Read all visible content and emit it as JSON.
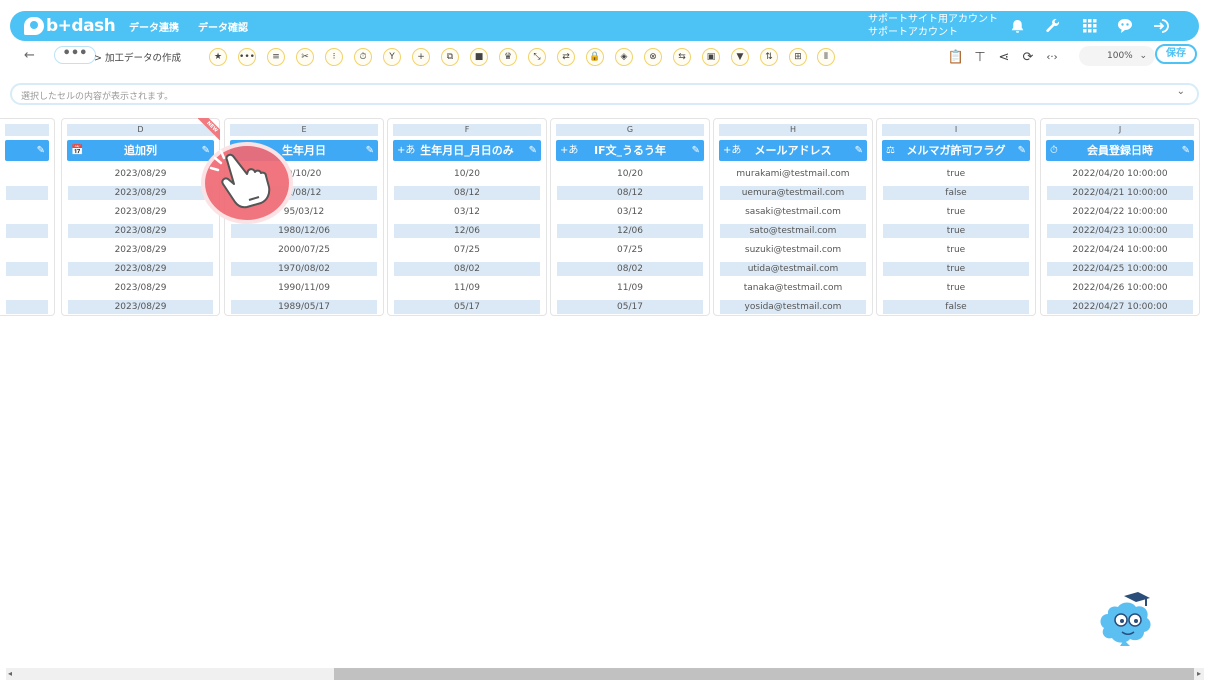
{
  "header": {
    "logo_text": "b+dash",
    "nav": [
      "データ連携",
      "データ確認"
    ],
    "account_line1": "サポートサイト用アカウント",
    "account_line2": "サポートアカウント",
    "icons": [
      "bell-icon",
      "wrench-icon",
      "apps-grid-icon",
      "chat-robot-icon",
      "logout-icon"
    ]
  },
  "toolbar": {
    "back": "←",
    "more": "•••",
    "breadcrumb": "> 加工データの作成",
    "tools": [
      {
        "name": "favorite-star-icon",
        "glyph": "★"
      },
      {
        "name": "more-dots-icon",
        "glyph": "•••"
      },
      {
        "name": "text-lines-icon",
        "glyph": "≡"
      },
      {
        "name": "tools-icon",
        "glyph": "✂"
      },
      {
        "name": "split-icon",
        "glyph": "⁝"
      },
      {
        "name": "timer-icon",
        "glyph": "⏱"
      },
      {
        "name": "merge-icon",
        "glyph": "Y"
      },
      {
        "name": "add-icon",
        "glyph": "+"
      },
      {
        "name": "copy-icon",
        "glyph": "⧉"
      },
      {
        "name": "delete-icon",
        "glyph": "■"
      },
      {
        "name": "crown-icon",
        "glyph": "♛"
      },
      {
        "name": "expand-icon",
        "glyph": "⤡"
      },
      {
        "name": "swap-icon",
        "glyph": "⇄"
      },
      {
        "name": "lock-icon",
        "glyph": "🔒"
      },
      {
        "name": "bag-icon",
        "glyph": "◈"
      },
      {
        "name": "clear-icon",
        "glyph": "⊗"
      },
      {
        "name": "replace-icon",
        "glyph": "⇆"
      },
      {
        "name": "frame-icon",
        "glyph": "▣"
      },
      {
        "name": "filter-icon",
        "glyph": "▼"
      },
      {
        "name": "sort-icon",
        "glyph": "⇅"
      },
      {
        "name": "table-icon",
        "glyph": "⊞"
      },
      {
        "name": "column-icon",
        "glyph": "⦀"
      }
    ],
    "right_icons": [
      {
        "name": "clipboard-icon",
        "glyph": "📋"
      },
      {
        "name": "flow-icon",
        "glyph": "⊤"
      },
      {
        "name": "share-icon",
        "glyph": "⋖"
      },
      {
        "name": "refresh-icon",
        "glyph": "⟳"
      },
      {
        "name": "code-icon",
        "glyph": "‹·›"
      }
    ],
    "zoom": "100%",
    "zoom_caret": "⌄",
    "save": "保存"
  },
  "cellbar": {
    "placeholder": "選択したセルの内容が表示されます。",
    "chevron": "⌄"
  },
  "columns": [
    {
      "letter": "",
      "title": "",
      "type_icon": "",
      "rows": [
        "",
        "",
        "",
        "",
        "",
        "",
        "",
        ""
      ]
    },
    {
      "letter": "D",
      "title": "追加列",
      "type_icon": "📅",
      "new_badge": "NEW",
      "rows": [
        "2023/08/29",
        "2023/08/29",
        "2023/08/29",
        "2023/08/29",
        "2023/08/29",
        "2023/08/29",
        "2023/08/29",
        "2023/08/29"
      ]
    },
    {
      "letter": "E",
      "title": "生年月日",
      "type_icon": "",
      "rows": [
        "0/10/20",
        "2/08/12",
        "95/03/12",
        "1980/12/06",
        "2000/07/25",
        "1970/08/02",
        "1990/11/09",
        "1989/05/17"
      ]
    },
    {
      "letter": "F",
      "title": "生年月日_月日のみ",
      "type_icon": "+あ",
      "rows": [
        "10/20",
        "08/12",
        "03/12",
        "12/06",
        "07/25",
        "08/02",
        "11/09",
        "05/17"
      ]
    },
    {
      "letter": "G",
      "title": "IF文_うるう年",
      "type_icon": "+あ",
      "rows": [
        "10/20",
        "08/12",
        "03/12",
        "12/06",
        "07/25",
        "08/02",
        "11/09",
        "05/17"
      ]
    },
    {
      "letter": "H",
      "title": "メールアドレス",
      "type_icon": "+あ",
      "rows": [
        "murakami@testmail.com",
        "uemura@testmail.com",
        "sasaki@testmail.com",
        "sato@testmail.com",
        "suzuki@testmail.com",
        "utida@testmail.com",
        "tanaka@testmail.com",
        "yosida@testmail.com"
      ]
    },
    {
      "letter": "I",
      "title": "メルマガ許可フラグ",
      "type_icon": "⚖",
      "rows": [
        "true",
        "false",
        "true",
        "true",
        "true",
        "true",
        "true",
        "false"
      ]
    },
    {
      "letter": "J",
      "title": "会員登録日時",
      "type_icon": "⏱",
      "rows": [
        "2022/04/20 10:00:00",
        "2022/04/21 10:00:00",
        "2022/04/22 10:00:00",
        "2022/04/23 10:00:00",
        "2022/04/24 10:00:00",
        "2022/04/25 10:00:00",
        "2022/04/26 10:00:00",
        "2022/04/27 10:00:00"
      ]
    }
  ],
  "edit_icon": "✎",
  "scroll": {
    "left": "◂",
    "right": "▸"
  }
}
